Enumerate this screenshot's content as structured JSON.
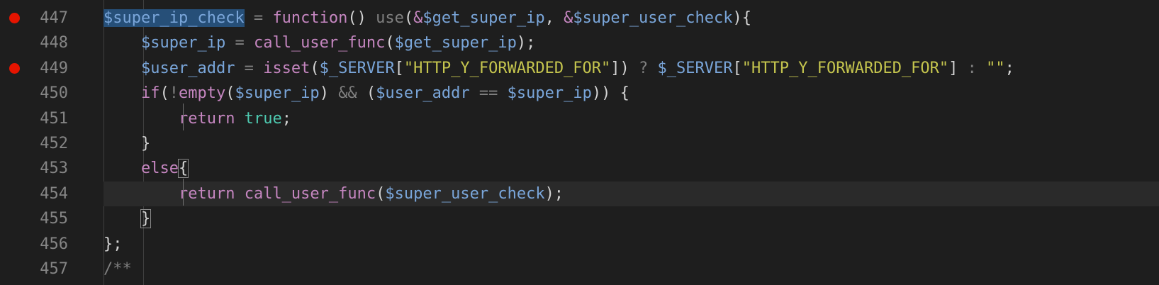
{
  "editor": {
    "lines": [
      {
        "num": "447",
        "bp": true,
        "tokens": [
          {
            "t": "$super_ip_check",
            "c": "t-var2 sel"
          },
          {
            "t": " = ",
            "c": "t-dim"
          },
          {
            "t": "function",
            "c": "t-fn"
          },
          {
            "t": "() ",
            "c": "t-pun"
          },
          {
            "t": "use",
            "c": "t-dim"
          },
          {
            "t": "(",
            "c": "t-pun"
          },
          {
            "t": "&",
            "c": "t-kw"
          },
          {
            "t": "$get_super_ip",
            "c": "t-var2"
          },
          {
            "t": ", ",
            "c": "t-pun"
          },
          {
            "t": "&",
            "c": "t-kw"
          },
          {
            "t": "$super_user_check",
            "c": "t-var2"
          },
          {
            "t": "){",
            "c": "t-pun"
          }
        ]
      },
      {
        "num": "448",
        "bp": false,
        "tokens": [
          {
            "t": "    ",
            "c": "t-pun"
          },
          {
            "t": "$super_ip",
            "c": "t-var2"
          },
          {
            "t": " = ",
            "c": "t-dim"
          },
          {
            "t": "call_user_func",
            "c": "t-fn"
          },
          {
            "t": "(",
            "c": "t-pun"
          },
          {
            "t": "$get_super_ip",
            "c": "t-var2"
          },
          {
            "t": ");",
            "c": "t-pun"
          }
        ]
      },
      {
        "num": "449",
        "bp": true,
        "tokens": [
          {
            "t": "    ",
            "c": "t-pun"
          },
          {
            "t": "$user_addr",
            "c": "t-var2"
          },
          {
            "t": " = ",
            "c": "t-dim"
          },
          {
            "t": "isset",
            "c": "t-fn"
          },
          {
            "t": "(",
            "c": "t-pun"
          },
          {
            "t": "$_SERVER",
            "c": "t-var2"
          },
          {
            "t": "[",
            "c": "t-pun"
          },
          {
            "t": "\"HTTP_Y_FORWARDED_FOR\"",
            "c": "t-yel"
          },
          {
            "t": "]) ",
            "c": "t-pun"
          },
          {
            "t": "?",
            "c": "t-dim"
          },
          {
            "t": " ",
            "c": "t-pun"
          },
          {
            "t": "$_SERVER",
            "c": "t-var2"
          },
          {
            "t": "[",
            "c": "t-pun"
          },
          {
            "t": "\"HTTP_Y_FORWARDED_FOR\"",
            "c": "t-yel"
          },
          {
            "t": "] ",
            "c": "t-pun"
          },
          {
            "t": ":",
            "c": "t-dim"
          },
          {
            "t": " ",
            "c": "t-pun"
          },
          {
            "t": "\"\"",
            "c": "t-yel"
          },
          {
            "t": ";",
            "c": "t-pun"
          }
        ]
      },
      {
        "num": "450",
        "bp": false,
        "tokens": [
          {
            "t": "    ",
            "c": "t-pun"
          },
          {
            "t": "if",
            "c": "t-fn"
          },
          {
            "t": "(",
            "c": "t-pun"
          },
          {
            "t": "!",
            "c": "t-dim"
          },
          {
            "t": "empty",
            "c": "t-fn"
          },
          {
            "t": "(",
            "c": "t-pun"
          },
          {
            "t": "$super_ip",
            "c": "t-var2"
          },
          {
            "t": ") ",
            "c": "t-pun"
          },
          {
            "t": "&&",
            "c": "t-dim"
          },
          {
            "t": " (",
            "c": "t-pun"
          },
          {
            "t": "$user_addr",
            "c": "t-var2"
          },
          {
            "t": " == ",
            "c": "t-dim"
          },
          {
            "t": "$super_ip",
            "c": "t-var2"
          },
          {
            "t": ")) {",
            "c": "t-pun"
          }
        ]
      },
      {
        "num": "451",
        "bp": false,
        "tokens": [
          {
            "t": "        ",
            "c": "t-pun"
          },
          {
            "t": "return",
            "c": "t-fn"
          },
          {
            "t": " ",
            "c": "t-pun"
          },
          {
            "t": "true",
            "c": "t-bool"
          },
          {
            "t": ";",
            "c": "t-pun"
          }
        ]
      },
      {
        "num": "452",
        "bp": false,
        "tokens": [
          {
            "t": "    ",
            "c": "t-pun"
          },
          {
            "t": "}",
            "c": "t-pun"
          }
        ]
      },
      {
        "num": "453",
        "bp": false,
        "tokens": [
          {
            "t": "    ",
            "c": "t-pun"
          },
          {
            "t": "else",
            "c": "t-fn"
          },
          {
            "t": "{",
            "c": "t-pun brk"
          }
        ]
      },
      {
        "num": "454",
        "bp": false,
        "current": true,
        "tokens": [
          {
            "t": "        ",
            "c": "t-pun"
          },
          {
            "t": "return",
            "c": "t-fn"
          },
          {
            "t": " ",
            "c": "t-pun"
          },
          {
            "t": "call_user_func",
            "c": "t-fn"
          },
          {
            "t": "(",
            "c": "t-pun"
          },
          {
            "t": "$super_user_check",
            "c": "t-var2"
          },
          {
            "t": ");",
            "c": "t-pun"
          }
        ]
      },
      {
        "num": "455",
        "bp": false,
        "tokens": [
          {
            "t": "    ",
            "c": "t-pun"
          },
          {
            "t": "}",
            "c": "t-pun brk"
          }
        ]
      },
      {
        "num": "456",
        "bp": false,
        "tokens": [
          {
            "t": "};",
            "c": "t-pun"
          }
        ]
      },
      {
        "num": "457",
        "bp": false,
        "tokens": [
          {
            "t": "/**",
            "c": "t-dim"
          }
        ]
      }
    ]
  }
}
